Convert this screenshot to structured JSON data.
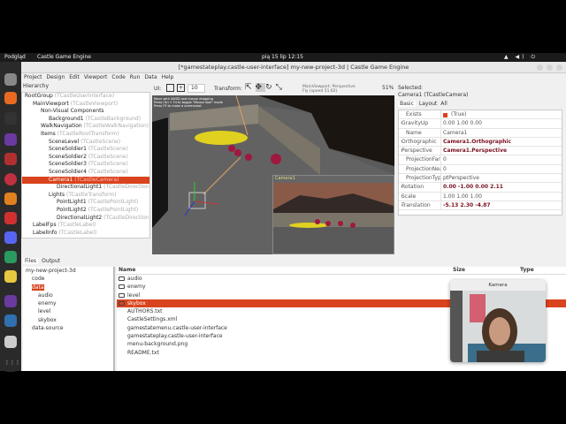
{
  "topbar": {
    "app": "Podgląd",
    "active": "Castle Game Engine",
    "clock": "pią 15 lip  12:15"
  },
  "dock": {
    "icons": [
      "files-icon",
      "firefox-icon",
      "terminal-icon",
      "emacs-icon",
      "stamp-icon",
      "castle-game-engine-icon",
      "blender-icon",
      "stack-icon",
      "discord-icon",
      "mail-lock-icon",
      "mail-icon",
      "emacs-icon",
      "image-viewer-icon",
      "document-icon",
      "apps-grid-icon"
    ]
  },
  "window": {
    "title": "[*gamestateplay.castle-user-interface] my-new-project-3d | Castle Game Engine"
  },
  "menu": [
    "Project",
    "Design",
    "Edit",
    "Viewport",
    "Code",
    "Run",
    "Data",
    "Help"
  ],
  "hierarchy": {
    "label": "Hierarchy",
    "items": [
      {
        "name": "RootGroup",
        "type": "(TCastleUserInterface)",
        "level": 0
      },
      {
        "name": "MainViewport",
        "type": "(TCastleViewport)",
        "level": 1
      },
      {
        "name": "Non-Visual Components",
        "type": "",
        "level": 2
      },
      {
        "name": "Background1",
        "type": "(TCastleBackground)",
        "level": 3
      },
      {
        "name": "WalkNavigation",
        "type": "(TCastleWalkNavigation)",
        "level": 2
      },
      {
        "name": "Items",
        "type": "(TCastleRootTransform)",
        "level": 2
      },
      {
        "name": "SceneLevel",
        "type": "(TCastleScene)",
        "level": 3
      },
      {
        "name": "SceneSoldier1",
        "type": "(TCastleScene)",
        "level": 3
      },
      {
        "name": "SceneSoldier2",
        "type": "(TCastleScene)",
        "level": 3
      },
      {
        "name": "SceneSoldier3",
        "type": "(TCastleScene)",
        "level": 3
      },
      {
        "name": "SceneSoldier4",
        "type": "(TCastleScene)",
        "level": 3
      },
      {
        "name": "Camera1",
        "type": "(TCastleCamera)",
        "level": 3,
        "selected": true
      },
      {
        "name": "DirectionalLight1",
        "type": "(TCastleDirectionalLight)",
        "level": 4
      },
      {
        "name": "Lights",
        "type": "(TCastleTransform)",
        "level": 3
      },
      {
        "name": "PointLight1",
        "type": "(TCastlePointLight)",
        "level": 4
      },
      {
        "name": "PointLight2",
        "type": "(TCastlePointLight)",
        "level": 4
      },
      {
        "name": "DirectionalLight2",
        "type": "(TCastleDirectionalLight)",
        "level": 4
      },
      {
        "name": "LabelFps",
        "type": "(TCastleLabel)",
        "level": 1
      },
      {
        "name": "LabelInfo",
        "type": "(TCastleLabel)",
        "level": 1
      }
    ]
  },
  "toolbar": {
    "ui_label": "UI:",
    "spin_value": "10",
    "transform_label": "Transform:",
    "viewport_info1": "MainViewport: Perspective",
    "viewport_info2": "Fly (speed 51.62)",
    "zoom": "51%"
  },
  "viewport": {
    "help1": "Move with AWSD and mouse dragging",
    "help2": "Press Ctrl + F4 to toggle \"Mouse look\" mode",
    "help3": "Press F5 to make a screenshot.",
    "preview_title": "Camera1"
  },
  "inspector": {
    "selected_label": "Selected:",
    "selected": "Camera1 (TCastleCamera)",
    "tabs": [
      "Basic",
      "Layout",
      "All"
    ],
    "props": [
      {
        "k": "Exists",
        "v": "(True)",
        "check": true
      },
      {
        "k": "GravityUp",
        "v": "0.00 1.00 0.00",
        "exp": true
      },
      {
        "k": "Name",
        "v": "Camera1"
      },
      {
        "k": "Orthographic",
        "v": "Camera1.Orthographic",
        "exp": true,
        "bold": true
      },
      {
        "k": "Perspective",
        "v": "Camera1.Perspective",
        "exp": true,
        "bold": true
      },
      {
        "k": "ProjectionFar",
        "v": "0"
      },
      {
        "k": "ProjectionNear",
        "v": "0"
      },
      {
        "k": "ProjectionType",
        "v": "ptPerspective"
      },
      {
        "k": "Rotation",
        "v": "0.00 -1.00 0.00 2.11",
        "exp": true,
        "bold": true
      },
      {
        "k": "Scale",
        "v": "1.00 1.00 1.00",
        "exp": true
      },
      {
        "k": "Translation",
        "v": "-5.13 2.30 -4.87",
        "exp": true,
        "bold": true
      }
    ]
  },
  "bottom": {
    "tabs": [
      "Files",
      "Output"
    ],
    "tree": [
      {
        "n": "my-new-project-3d",
        "l": 0
      },
      {
        "n": "code",
        "l": 1
      },
      {
        "n": "data",
        "l": 1,
        "selected": true
      },
      {
        "n": "audio",
        "l": 2
      },
      {
        "n": "enemy",
        "l": 2
      },
      {
        "n": "level",
        "l": 2
      },
      {
        "n": "skybox",
        "l": 2
      },
      {
        "n": "data-source",
        "l": 1
      }
    ],
    "columns": [
      "Name",
      "Size",
      "Type"
    ],
    "files": [
      {
        "n": "audio",
        "folder": true,
        "s": ""
      },
      {
        "n": "enemy",
        "folder": true,
        "s": ""
      },
      {
        "n": "level",
        "folder": true,
        "s": ""
      },
      {
        "n": "skybox",
        "folder": true,
        "s": "",
        "selected": true
      },
      {
        "n": "AUTHORS.txt",
        "s": "1 kB"
      },
      {
        "n": "CastleSettings.xml",
        "s": "291 byt"
      },
      {
        "n": "gamestatemenu.castle-user-interface",
        "s": "3 kB"
      },
      {
        "n": "gamestateplay.castle-user-interface",
        "s": "10 kB"
      },
      {
        "n": "menu-background.png",
        "s": "205 kB"
      },
      {
        "n": "README.txt",
        "s": "132 byt"
      }
    ]
  },
  "kamera": {
    "title": "Kamera"
  },
  "colors": {
    "accent": "#d9441e",
    "bold_value": "#7a1020"
  }
}
